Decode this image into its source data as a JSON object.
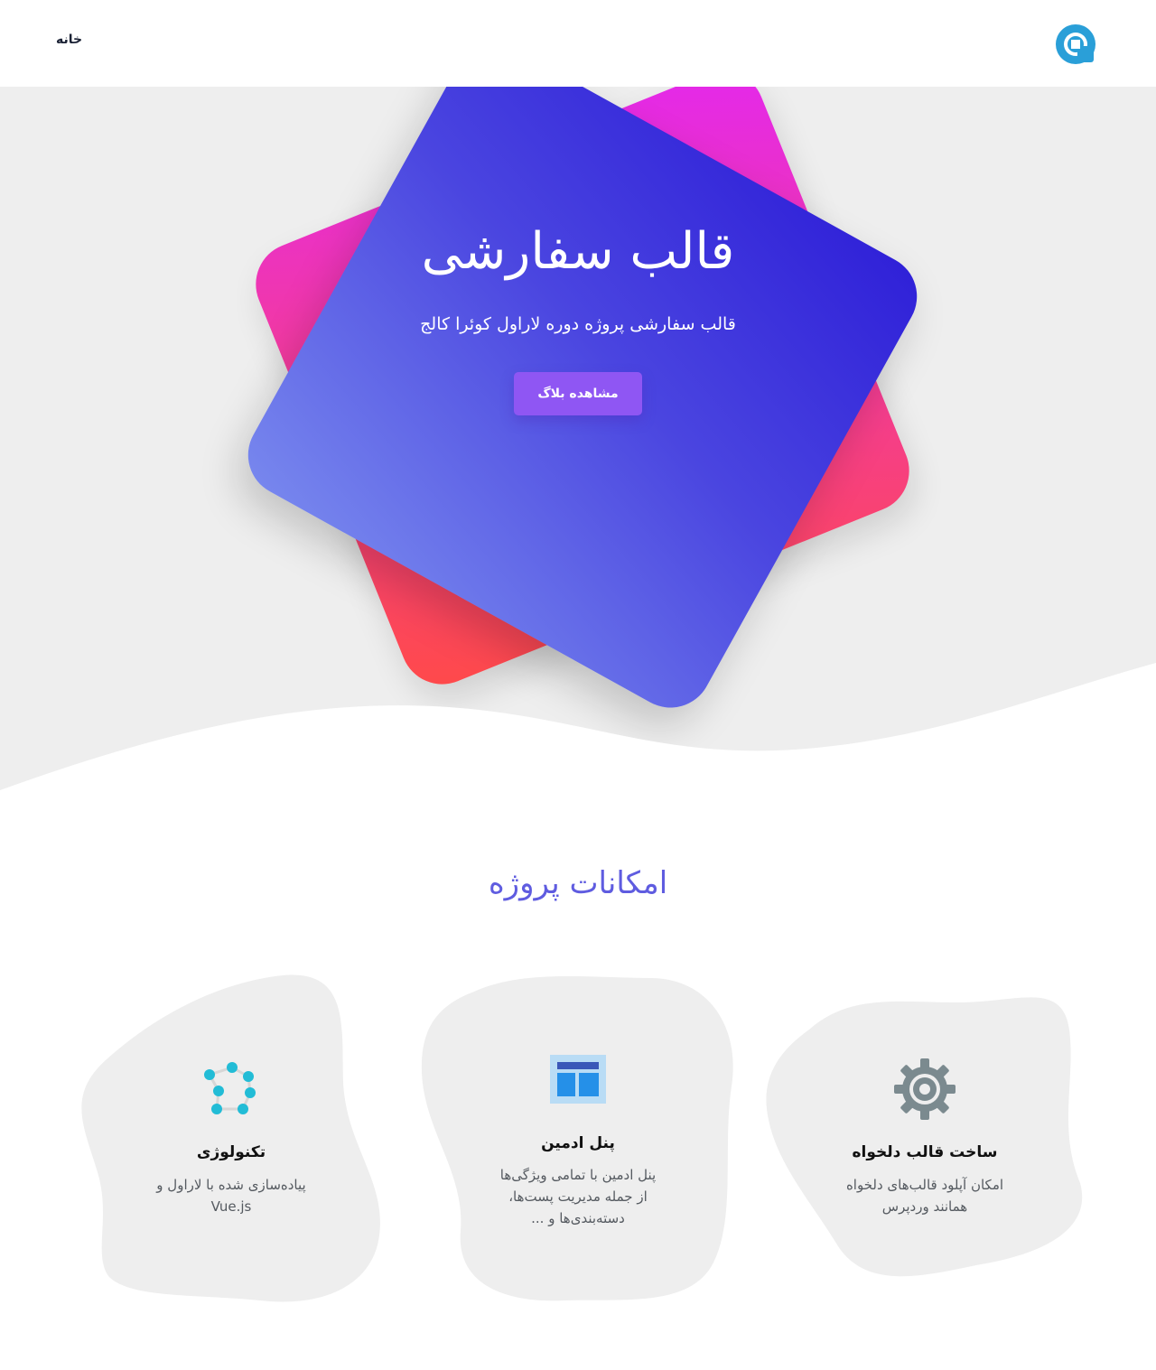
{
  "header": {
    "logo_icon": "q-logo-icon",
    "nav": [
      {
        "label": "خانه"
      }
    ]
  },
  "hero": {
    "title": "قالب سفارشی",
    "subtitle": "قالب سفارشی پروژه دوره لاراول کوئرا کالج",
    "button_label": "مشاهده بلاگ"
  },
  "features": {
    "title": "امکانات پروژه",
    "items": [
      {
        "icon": "gear-icon",
        "title": "ساخت قالب دلخواه",
        "desc_lines": [
          "امکان آپلود قالب‌های دلخواه",
          "همانند وردپرس"
        ]
      },
      {
        "icon": "dashboard-layout-icon",
        "title": "پنل ادمین",
        "desc_lines": [
          "پنل ادمین با تمامی ویژگی‌ها",
          "از جمله مدیریت پست‌ها،",
          "دسته‌بندی‌ها و ..."
        ]
      },
      {
        "icon": "network-nodes-icon",
        "title": "تکنولوژی",
        "desc_lines": [
          "پیاده‌سازی شده با لاراول و",
          "Vue.js"
        ]
      }
    ]
  },
  "colors": {
    "accent": "#8f56f3",
    "section_title": "#5f5ce0",
    "hero_bg": "#eeeeee",
    "card_blue": "#4a45e0",
    "card_pink": "#f23aa0"
  }
}
